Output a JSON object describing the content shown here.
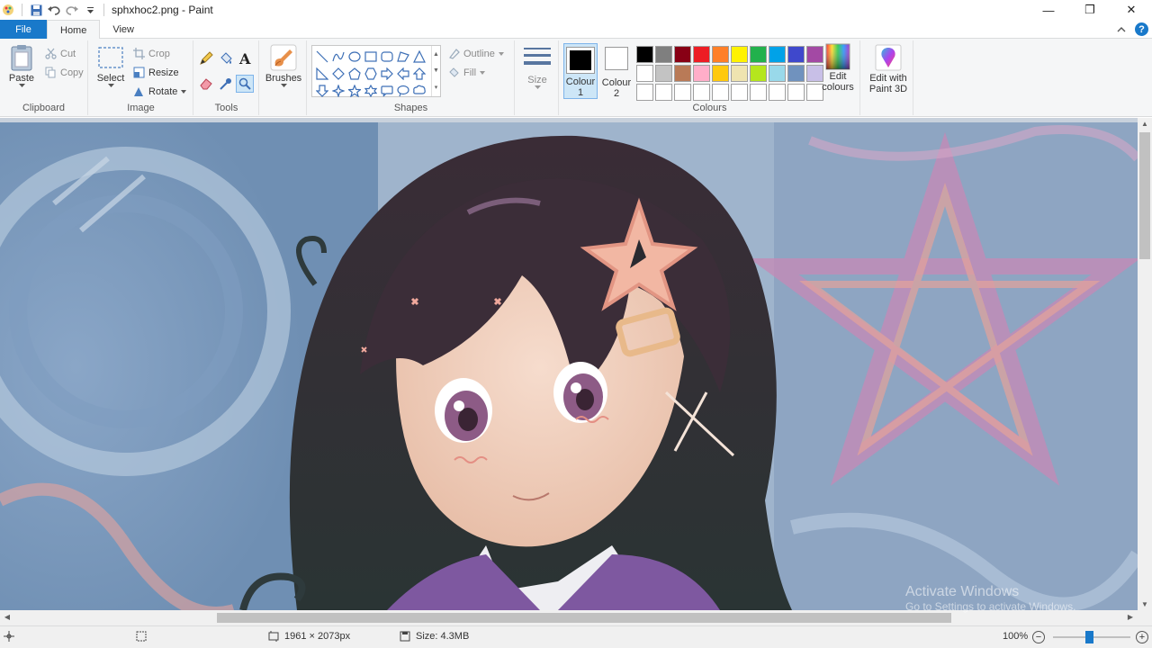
{
  "window": {
    "title": "sphxhoc2.png - Paint",
    "minimize": "—",
    "maximize": "❐",
    "close": "✕"
  },
  "tabs": {
    "file": "File",
    "home": "Home",
    "view": "View"
  },
  "help": "?",
  "clipboard": {
    "paste": "Paste",
    "cut": "Cut",
    "copy": "Copy",
    "group": "Clipboard"
  },
  "image": {
    "select": "Select",
    "crop": "Crop",
    "resize": "Resize",
    "rotate": "Rotate",
    "group": "Image"
  },
  "tools": {
    "group": "Tools",
    "text_glyph": "A"
  },
  "brushes": {
    "label": "Brushes"
  },
  "shapes": {
    "outline": "Outline",
    "fill": "Fill",
    "group": "Shapes"
  },
  "size": {
    "label": "Size"
  },
  "colours": {
    "colour1_line1": "Colour",
    "colour1_line2": "1",
    "colour2_line1": "Colour",
    "colour2_line2": "2",
    "edit_line1": "Edit",
    "edit_line2": "colours",
    "group": "Colours",
    "colour1_value": "#000000",
    "colour2_value": "#ffffff",
    "palette": [
      "#000000",
      "#7f7f7f",
      "#880015",
      "#ed1c24",
      "#ff7f27",
      "#fff200",
      "#22b14c",
      "#00a2e8",
      "#3f48cc",
      "#a349a4",
      "#ffffff",
      "#c3c3c3",
      "#b97a57",
      "#ffaec9",
      "#ffc90e",
      "#efe4b0",
      "#b5e61d",
      "#99d9ea",
      "#7092be",
      "#c8bfe7",
      "#ffffff",
      "#ffffff",
      "#ffffff",
      "#ffffff",
      "#ffffff",
      "#ffffff",
      "#ffffff",
      "#ffffff",
      "#ffffff",
      "#ffffff"
    ]
  },
  "paint3d": {
    "line1": "Edit with",
    "line2": "Paint 3D"
  },
  "status": {
    "dimensions": "1961 × 2073px",
    "size": "Size: 4.3MB",
    "zoom": "100%",
    "zoom_out": "−",
    "zoom_in": "+"
  },
  "watermark": {
    "line1": "Activate Windows",
    "line2": "Go to Settings to activate Windows."
  }
}
